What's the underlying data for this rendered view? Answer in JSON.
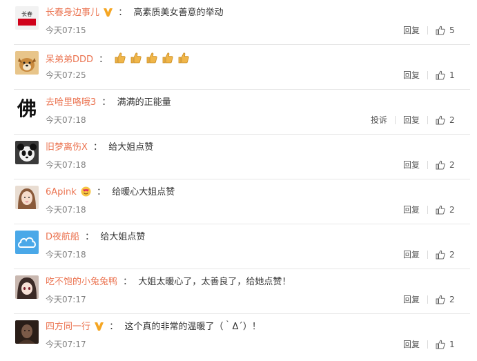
{
  "comments": [
    {
      "name": "长春身边事儿",
      "verified": true,
      "text": "高素质美女善意的举动",
      "time": "今天07:15",
      "reply": "回复",
      "likes": "5",
      "avatar": "logo",
      "avatar_text": "长春"
    },
    {
      "name": "呆弟弟DDD",
      "verified": false,
      "text": "",
      "emoji": "thumbs-up x5",
      "time": "今天07:25",
      "reply": "回复",
      "likes": "1",
      "avatar": "dog"
    },
    {
      "name": "去哈里咯哦3",
      "verified": false,
      "text": "满满的正能量",
      "time": "今天07:18",
      "report": "投诉",
      "reply": "回复",
      "likes": "2",
      "avatar": "calligraphy",
      "avatar_text": "佛"
    },
    {
      "name": "旧梦离伤X",
      "verified": false,
      "text": "给大姐点赞",
      "time": "今天07:18",
      "reply": "回复",
      "likes": "2",
      "avatar": "panda"
    },
    {
      "name": "6Apink",
      "verified": false,
      "badge": "heart-eyes",
      "text": "给暖心大姐点赞",
      "time": "今天07:18",
      "reply": "回复",
      "likes": "2",
      "avatar": "girl"
    },
    {
      "name": "D夜航船",
      "verified": false,
      "text": "给大姐点赞",
      "time": "今天07:18",
      "reply": "回复",
      "likes": "2",
      "avatar": "cloud"
    },
    {
      "name": "吃不饱的小兔兔鸭",
      "verified": false,
      "text": "大姐太暖心了，太善良了，给她点赞！",
      "time": "今天07:17",
      "reply": "回复",
      "likes": "2",
      "avatar": "anime"
    },
    {
      "name": "四方同一行",
      "verified": true,
      "text": "这个真的非常的温暖了（｀Δ´）！",
      "time": "今天07:17",
      "reply": "回复",
      "likes": "1",
      "avatar": "dark"
    }
  ],
  "colors": {
    "name": "#eb7350",
    "text": "#333333",
    "meta": "#808080",
    "verified": "#f5a623"
  }
}
